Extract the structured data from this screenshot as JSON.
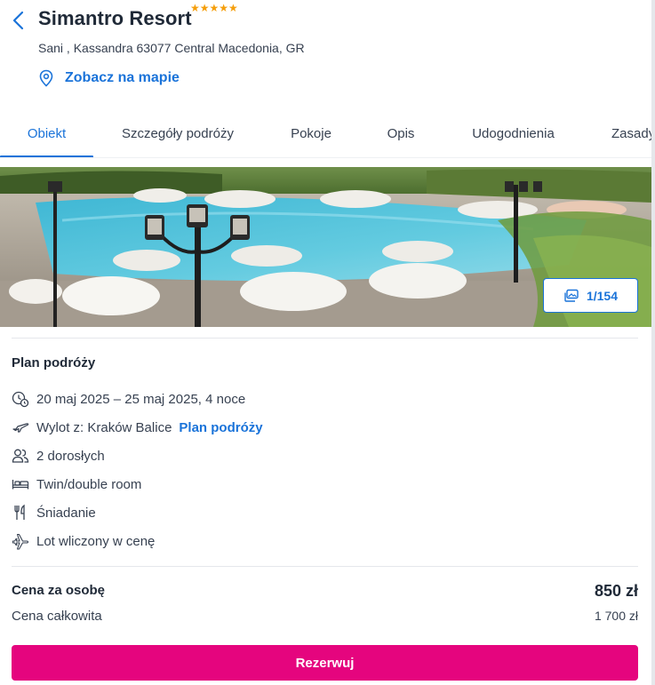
{
  "header": {
    "hotel_name": "Simantro Resort",
    "stars": 5,
    "star_glyph": "★★★★★",
    "address": "Sani , Kassandra 63077 Central Macedonia, GR",
    "map_link": "Zobacz na mapie"
  },
  "tabs": [
    {
      "label": "Obiekt",
      "active": true
    },
    {
      "label": "Szczegóły podróży",
      "active": false
    },
    {
      "label": "Pokoje",
      "active": false
    },
    {
      "label": "Opis",
      "active": false
    },
    {
      "label": "Udogodnienia",
      "active": false
    },
    {
      "label": "Zasady",
      "active": false
    }
  ],
  "gallery": {
    "counter": "1/154"
  },
  "trip_plan": {
    "title": "Plan podróży",
    "dates": "20 maj 2025 – 25 maj 2025, 4 noce",
    "departure": "Wylot z: Kraków Balice",
    "departure_link": "Plan podróży",
    "guests": "2 dorosłych",
    "room": "Twin/double room",
    "board": "Śniadanie",
    "flight": "Lot wliczony w cenę",
    "icons": [
      "calendar-clock-icon",
      "plane-departure-icon",
      "people-icon",
      "bed-icon",
      "cutlery-icon",
      "plane-icon"
    ]
  },
  "pricing": {
    "per_person_label": "Cena za osobę",
    "per_person_value": "850 zł",
    "total_label": "Cena całkowita",
    "total_value": "1 700 zł"
  },
  "book_button": "Rezerwuj",
  "colors": {
    "accent": "#1a73d9",
    "book_button": "#e5057e",
    "stars": "#f59e0b",
    "text": "#1f2937"
  }
}
